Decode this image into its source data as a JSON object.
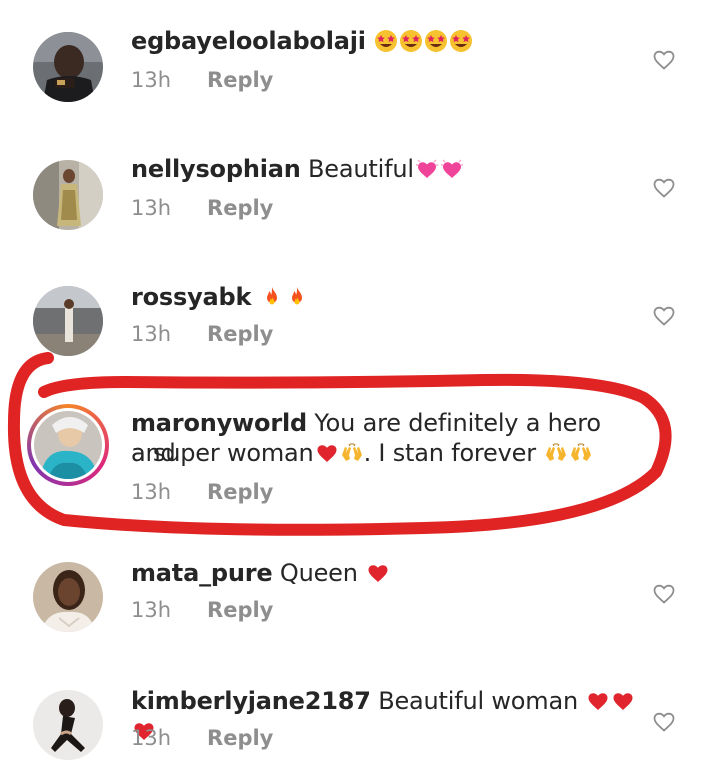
{
  "comments": [
    {
      "username": "egbayeloolabolaji",
      "text": "",
      "emojis": [
        "star-struck",
        "star-struck",
        "star-struck",
        "star-struck"
      ],
      "time": "13h",
      "reply": "Reply"
    },
    {
      "username": "nellysophian",
      "text": "Beautiful",
      "emojis": [
        "sparkling-heart",
        "sparkling-heart"
      ],
      "time": "13h",
      "reply": "Reply"
    },
    {
      "username": "rossyabk",
      "text": "",
      "emojis": [
        "fire",
        "fire"
      ],
      "time": "13h",
      "reply": "Reply"
    },
    {
      "username": "maronyworld",
      "text_line1": "You are definitely a hero and",
      "text_line2a": "a super woman",
      "text_line2b": ". I stan forever",
      "time": "13h",
      "reply": "Reply"
    },
    {
      "username": "mata_pure",
      "text": "Queen",
      "emojis": [
        "red-heart"
      ],
      "time": "13h",
      "reply": "Reply"
    },
    {
      "username": "kimberlyjane2187",
      "text": "Beautiful woman",
      "emojis": [
        "red-heart",
        "red-heart",
        "red-heart"
      ],
      "time": "13h",
      "reply": "Reply"
    }
  ],
  "colors": {
    "annotation": "#e02424",
    "meta": "#8e8e8e",
    "text": "#262626"
  }
}
